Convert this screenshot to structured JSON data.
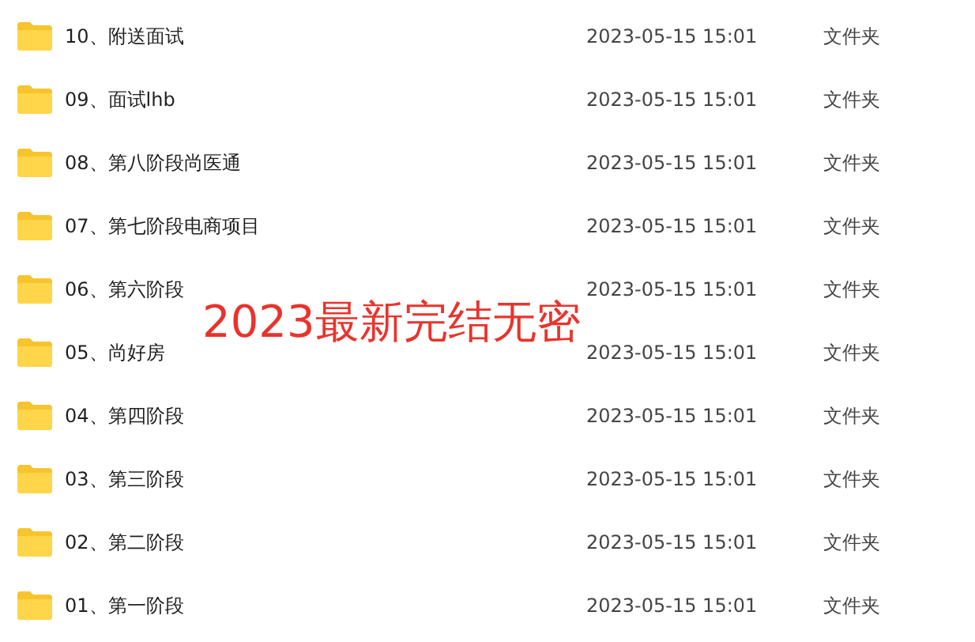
{
  "files": [
    {
      "name": "10、附送面试",
      "modified": "2023-05-15 15:01",
      "type": "文件夹"
    },
    {
      "name": "09、面试lhb",
      "modified": "2023-05-15 15:01",
      "type": "文件夹"
    },
    {
      "name": "08、第八阶段尚医通",
      "modified": "2023-05-15 15:01",
      "type": "文件夹"
    },
    {
      "name": "07、第七阶段电商项目",
      "modified": "2023-05-15 15:01",
      "type": "文件夹"
    },
    {
      "name": "06、第六阶段",
      "modified": "2023-05-15 15:01",
      "type": "文件夹"
    },
    {
      "name": "05、尚好房",
      "modified": "2023-05-15 15:01",
      "type": "文件夹"
    },
    {
      "name": "04、第四阶段",
      "modified": "2023-05-15 15:01",
      "type": "文件夹"
    },
    {
      "name": "03、第三阶段",
      "modified": "2023-05-15 15:01",
      "type": "文件夹"
    },
    {
      "name": "02、第二阶段",
      "modified": "2023-05-15 15:01",
      "type": "文件夹"
    },
    {
      "name": "01、第一阶段",
      "modified": "2023-05-15 15:01",
      "type": "文件夹"
    }
  ],
  "overlay_text": "2023最新完结无密"
}
